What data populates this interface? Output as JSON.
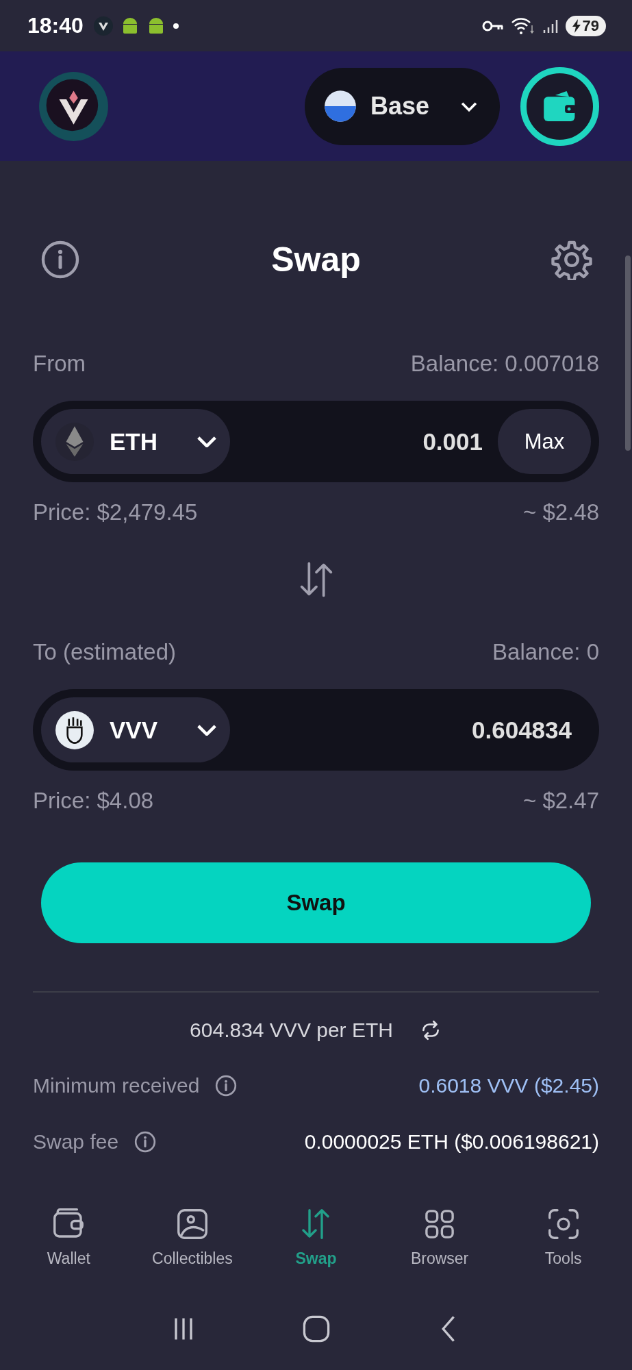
{
  "status_bar": {
    "time": "18:40",
    "battery": "79"
  },
  "header": {
    "network": "Base"
  },
  "title": "Swap",
  "from": {
    "label": "From",
    "balance": "Balance: 0.007018",
    "token": "ETH",
    "amount": "0.001",
    "max_button": "Max",
    "price": "Price: $2,479.45",
    "value": "~ $2.48"
  },
  "to": {
    "label": "To (estimated)",
    "balance": "Balance: 0",
    "token": "VVV",
    "amount": "0.604834",
    "price": "Price: $4.08",
    "value": "~ $2.47"
  },
  "swap_button": "Swap",
  "rate": "604.834 VVV per ETH",
  "details": [
    {
      "label": "Minimum received",
      "value": "0.6018 VVV ($2.45)",
      "highlighted": true
    },
    {
      "label": "Swap fee",
      "value": "0.0000025 ETH ($0.006198621)",
      "highlighted": false
    }
  ],
  "nav": [
    {
      "kind": "wallet",
      "label": "Wallet",
      "selected": false
    },
    {
      "kind": "collectibles",
      "label": "Collectibles",
      "selected": false
    },
    {
      "kind": "swap",
      "label": "Swap",
      "selected": true
    },
    {
      "kind": "browser",
      "label": "Browser",
      "selected": false
    },
    {
      "kind": "tools",
      "label": "Tools",
      "selected": false
    }
  ]
}
